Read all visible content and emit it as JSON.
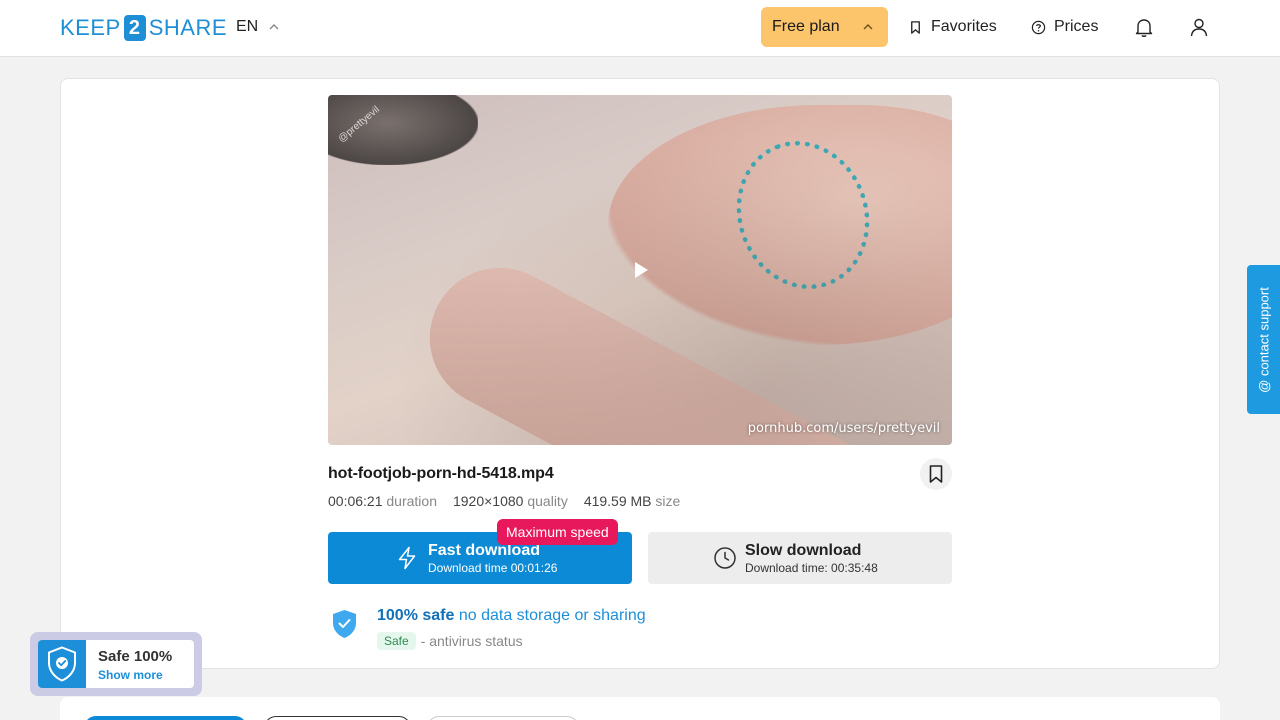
{
  "header": {
    "logo_left": "KEEP",
    "logo_mid": "2",
    "logo_right": "SHARE",
    "language": "EN",
    "plan_label": "Free plan",
    "favorites_label": "Favorites",
    "prices_label": "Prices"
  },
  "video": {
    "watermark": "pornhub.com/users/prettyevil",
    "corner_watermark": "@prettyevil"
  },
  "file": {
    "name": "hot-footjob-porn-hd-5418.mp4",
    "duration": "00:06:21",
    "duration_label": "duration",
    "quality": "1920×1080",
    "quality_label": "quality",
    "size": "419.59 MB",
    "size_label": "size"
  },
  "download": {
    "fast_title": "Fast download",
    "fast_time": "Download time 00:01:26",
    "badge": "Maximum speed",
    "slow_title": "Slow download",
    "slow_time": "Download time: 00:35:48"
  },
  "safety": {
    "bold": "100% safe",
    "rest": "no data storage or sharing",
    "tag": "Safe",
    "status": "- antivirus status"
  },
  "support_label": "@ contact support",
  "safe_widget": {
    "title": "Safe 100%",
    "link": "Show more"
  },
  "colors": {
    "primary": "#0d8ad6",
    "plan": "#fcc46b",
    "badge": "#e8185c",
    "support": "#1e9be0"
  }
}
